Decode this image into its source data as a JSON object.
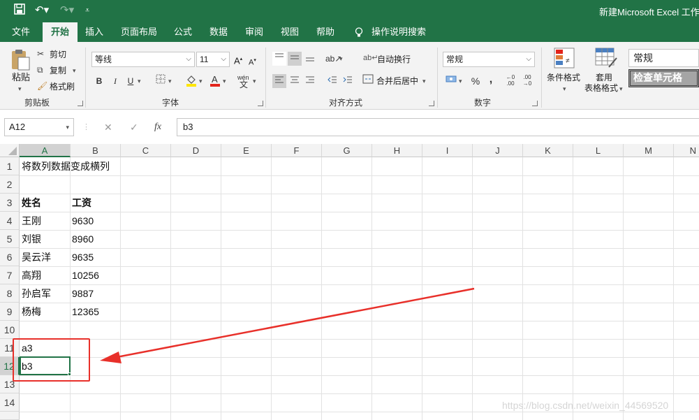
{
  "qat": {
    "save_icon": "save-icon",
    "undo_icon": "undo-icon",
    "redo_icon": "redo-icon",
    "customize_icon": "customize-icon"
  },
  "title": "新建Microsoft Excel 工作",
  "tabs": [
    "文件",
    "开始",
    "插入",
    "页面布局",
    "公式",
    "数据",
    "审阅",
    "视图",
    "帮助"
  ],
  "tell_me": "操作说明搜索",
  "clipboard": {
    "paste": "粘贴",
    "cut": "剪切",
    "copy": "复制",
    "format_painter": "格式刷",
    "label": "剪贴板"
  },
  "font": {
    "name": "等线",
    "size": "11",
    "bold": "B",
    "italic": "I",
    "underline": "U",
    "wen": "wén",
    "label": "字体"
  },
  "align": {
    "wrap": "自动换行",
    "merge": "合并后居中",
    "label": "对齐方式"
  },
  "number": {
    "format": "常规",
    "percent": "%",
    "comma": ",",
    "label": "数字"
  },
  "styles": {
    "conditional": "条件格式",
    "table_line1": "套用",
    "table_line2": "表格格式",
    "style_normal": "常规",
    "style_check": "检查单元格"
  },
  "formula_bar": {
    "name_box": "A12",
    "cancel": "✕",
    "enter": "✓",
    "fx": "fx",
    "content": "b3"
  },
  "columns": [
    "A",
    "B",
    "C",
    "D",
    "E",
    "F",
    "G",
    "H",
    "I",
    "J",
    "K",
    "L",
    "M",
    "N"
  ],
  "rows": [
    "1",
    "2",
    "3",
    "4",
    "5",
    "6",
    "7",
    "8",
    "9",
    "10",
    "11",
    "12",
    "13",
    "14"
  ],
  "cells": {
    "a1": "将数列数据变成横列",
    "a3": "姓名",
    "b3": "工资",
    "a4": "王刚",
    "b4": "9630",
    "a5": "刘银",
    "b5": "8960",
    "a6": "吴云洋",
    "b6": "9635",
    "a7": "高翔",
    "b7": "10256",
    "a8": "孙启军",
    "b8": "9887",
    "a9": "杨梅",
    "b9": "12365",
    "a11": "a3",
    "a12": "b3"
  },
  "watermark": "https://blog.csdn.net/weixin_44569520",
  "colors": {
    "accent": "#217346",
    "annotation": "#e8302a"
  }
}
